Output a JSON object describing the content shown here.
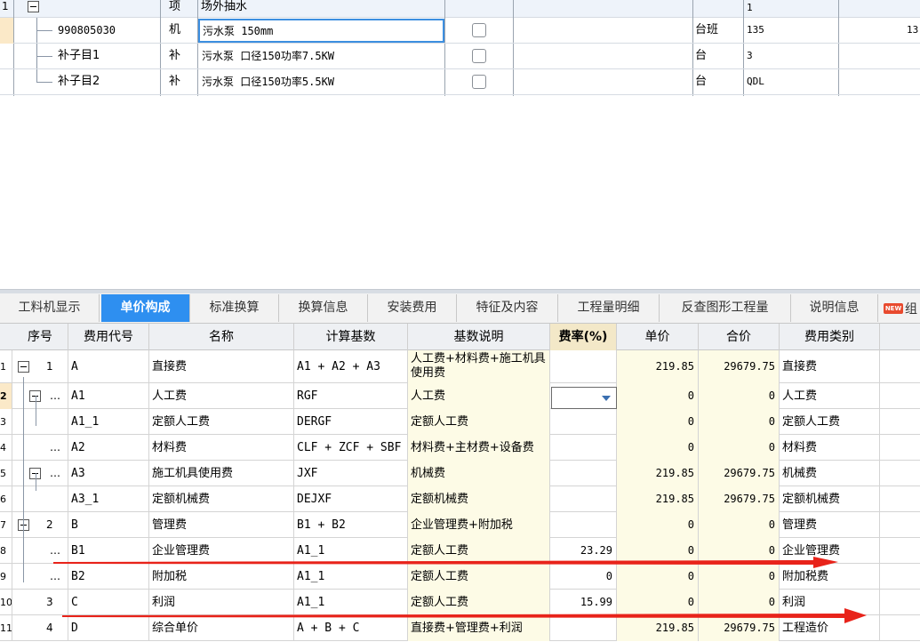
{
  "top_grid": {
    "rows": [
      {
        "index": "1",
        "code": "",
        "type": "项",
        "name": "场外抽水",
        "unit": "",
        "qty": "1",
        "extra": ""
      },
      {
        "index": "",
        "code": "990805030",
        "type": "机",
        "name": "污水泵 150mm",
        "unit": "台班",
        "qty": "135",
        "extra": "13"
      },
      {
        "index": "",
        "code": "补子目1",
        "type": "补",
        "name": "污水泵 口径150功率7.5KW",
        "unit": "台",
        "qty": "3",
        "extra": ""
      },
      {
        "index": "",
        "code": "补子目2",
        "type": "补",
        "name": "污水泵 口径150功率5.5KW",
        "unit": "台",
        "qty": "QDL",
        "extra": ""
      }
    ]
  },
  "tabs": [
    {
      "label": "工料机显示"
    },
    {
      "label": "单价构成"
    },
    {
      "label": "标准换算"
    },
    {
      "label": "换算信息"
    },
    {
      "label": "安装费用"
    },
    {
      "label": "特征及内容"
    },
    {
      "label": "工程量明细"
    },
    {
      "label": "反查图形工程量"
    },
    {
      "label": "说明信息"
    },
    {
      "label": "组"
    }
  ],
  "new_badge": "NEW",
  "bottom_grid": {
    "headers": [
      "序号",
      "费用代号",
      "名称",
      "计算基数",
      "基数说明",
      "费率(%)",
      "单价",
      "合价",
      "费用类别"
    ],
    "rows": [
      {
        "row": "1",
        "seq": "1",
        "code": "A",
        "name": "直接费",
        "base": "A1 + A2 + A3",
        "desc": "人工费+材料费+施工机具使用费",
        "rate": "",
        "price": "219.85",
        "total": "29679.75",
        "cat": "直接费"
      },
      {
        "row": "2",
        "seq": "…",
        "code": "A1",
        "name": "人工费",
        "base": "RGF",
        "desc": "人工费",
        "rate": "",
        "price": "0",
        "total": "0",
        "cat": "人工费"
      },
      {
        "row": "3",
        "seq": "",
        "code": "A1_1",
        "name": "定额人工费",
        "base": "DERGF",
        "desc": "定额人工费",
        "rate": "",
        "price": "0",
        "total": "0",
        "cat": "定额人工费"
      },
      {
        "row": "4",
        "seq": "…",
        "code": "A2",
        "name": "材料费",
        "base": "CLF + ZCF + SBF",
        "desc": "材料费+主材费+设备费",
        "rate": "",
        "price": "0",
        "total": "0",
        "cat": "材料费"
      },
      {
        "row": "5",
        "seq": "…",
        "code": "A3",
        "name": "施工机具使用费",
        "base": "JXF",
        "desc": "机械费",
        "rate": "",
        "price": "219.85",
        "total": "29679.75",
        "cat": "机械费"
      },
      {
        "row": "6",
        "seq": "",
        "code": "A3_1",
        "name": "定额机械费",
        "base": "DEJXF",
        "desc": "定额机械费",
        "rate": "",
        "price": "219.85",
        "total": "29679.75",
        "cat": "定额机械费"
      },
      {
        "row": "7",
        "seq": "2",
        "code": "B",
        "name": "管理费",
        "base": "B1 + B2",
        "desc": "企业管理费+附加税",
        "rate": "",
        "price": "0",
        "total": "0",
        "cat": "管理费"
      },
      {
        "row": "8",
        "seq": "…",
        "code": "B1",
        "name": "企业管理费",
        "base": "A1_1",
        "desc": "定额人工费",
        "rate": "23.29",
        "price": "0",
        "total": "0",
        "cat": "企业管理费"
      },
      {
        "row": "9",
        "seq": "…",
        "code": "B2",
        "name": "附加税",
        "base": "A1_1",
        "desc": "定额人工费",
        "rate": "0",
        "price": "0",
        "total": "0",
        "cat": "附加税费"
      },
      {
        "row": "10",
        "seq": "3",
        "code": "C",
        "name": "利润",
        "base": "A1_1",
        "desc": "定额人工费",
        "rate": "15.99",
        "price": "0",
        "total": "0",
        "cat": "利润"
      },
      {
        "row": "11",
        "seq": "4",
        "code": "D",
        "name": "综合单价",
        "base": "A + B + C",
        "desc": "直接费+管理费+利润",
        "rate": "",
        "price": "219.85",
        "total": "29679.75",
        "cat": "工程造价"
      }
    ]
  },
  "colors": {
    "tab_active": "#2e8ff0",
    "arrow": "#e8231a",
    "highlight_col": "#fdfbe6",
    "selected_row": "#fbe9c8"
  }
}
